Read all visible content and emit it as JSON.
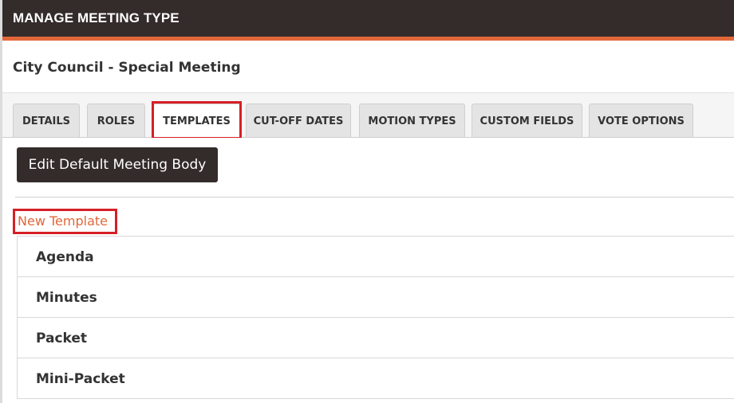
{
  "header": {
    "title": "MANAGE MEETING TYPE"
  },
  "meeting": {
    "name": "City Council - Special Meeting"
  },
  "tabs": [
    {
      "label": "DETAILS"
    },
    {
      "label": "ROLES"
    },
    {
      "label": "TEMPLATES"
    },
    {
      "label": "CUT-OFF DATES"
    },
    {
      "label": "MOTION TYPES"
    },
    {
      "label": "CUSTOM FIELDS"
    },
    {
      "label": "VOTE OPTIONS"
    }
  ],
  "content": {
    "edit_button_label": "Edit Default Meeting Body",
    "new_template_label": "New Template",
    "templates": [
      {
        "name": "Agenda"
      },
      {
        "name": "Minutes"
      },
      {
        "name": "Packet"
      },
      {
        "name": "Mini-Packet"
      }
    ]
  },
  "colors": {
    "header_bg": "#342b2b",
    "accent": "#e2673a",
    "highlight": "#d61f26"
  }
}
